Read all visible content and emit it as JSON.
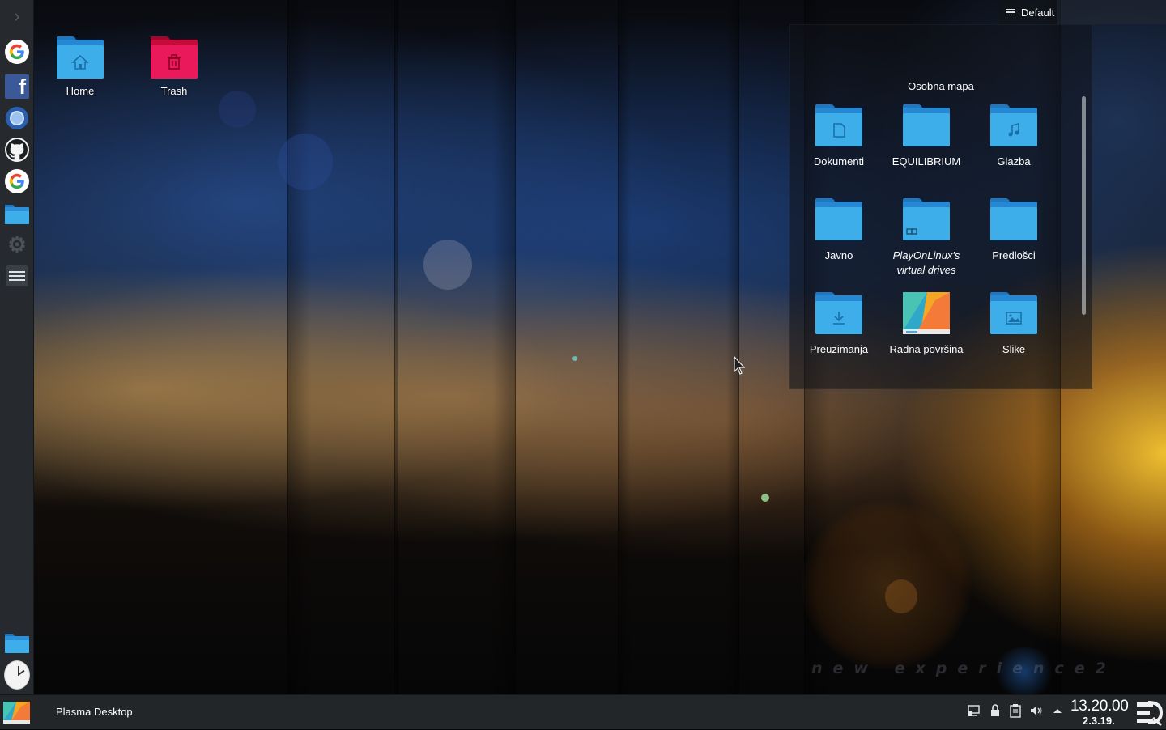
{
  "desktop": {
    "icons": [
      {
        "label": "Home"
      },
      {
        "label": "Trash"
      }
    ],
    "wallpaper_text": "new experience2"
  },
  "dock": {
    "items": [
      {
        "icon": "google-icon"
      },
      {
        "icon": "facebook-icon"
      },
      {
        "icon": "chromium-icon"
      },
      {
        "icon": "github-icon"
      },
      {
        "icon": "google-icon"
      },
      {
        "icon": "folder-icon"
      },
      {
        "icon": "kde-gear-icon"
      },
      {
        "icon": "settings-icon"
      },
      {
        "icon": "folder-icon"
      },
      {
        "icon": "clock-icon"
      },
      {
        "icon": "application-launcher-icon"
      }
    ]
  },
  "folder_view": {
    "layout_label": "Default",
    "title": "Osobna mapa",
    "items": [
      {
        "label": "Dokumenti",
        "icon": "documents-folder-icon"
      },
      {
        "label": "EQUILIBRIUM",
        "icon": "folder-icon"
      },
      {
        "label": "Glazba",
        "icon": "music-folder-icon"
      },
      {
        "label": "Javno",
        "icon": "folder-icon"
      },
      {
        "label": "PlayOnLinux's virtual drives",
        "icon": "link-folder-icon"
      },
      {
        "label": "Predlošci",
        "icon": "folder-icon"
      },
      {
        "label": "Preuzimanja",
        "icon": "downloads-folder-icon"
      },
      {
        "label": "Radna površina",
        "icon": "desktop-folder-icon"
      },
      {
        "label": "Slike",
        "icon": "pictures-folder-icon"
      }
    ]
  },
  "taskbar": {
    "window_title": "Plasma Desktop",
    "tray_icons": [
      "display-icon",
      "lock-icon",
      "clipboard-icon",
      "volume-icon",
      "expand-arrow-icon"
    ],
    "clock": {
      "time": "13.20.00",
      "date": "2.3.19."
    }
  },
  "colors": {
    "folder_blue": "#3daee9",
    "trash_red": "#e9195b",
    "panel_bg": "#232629"
  }
}
